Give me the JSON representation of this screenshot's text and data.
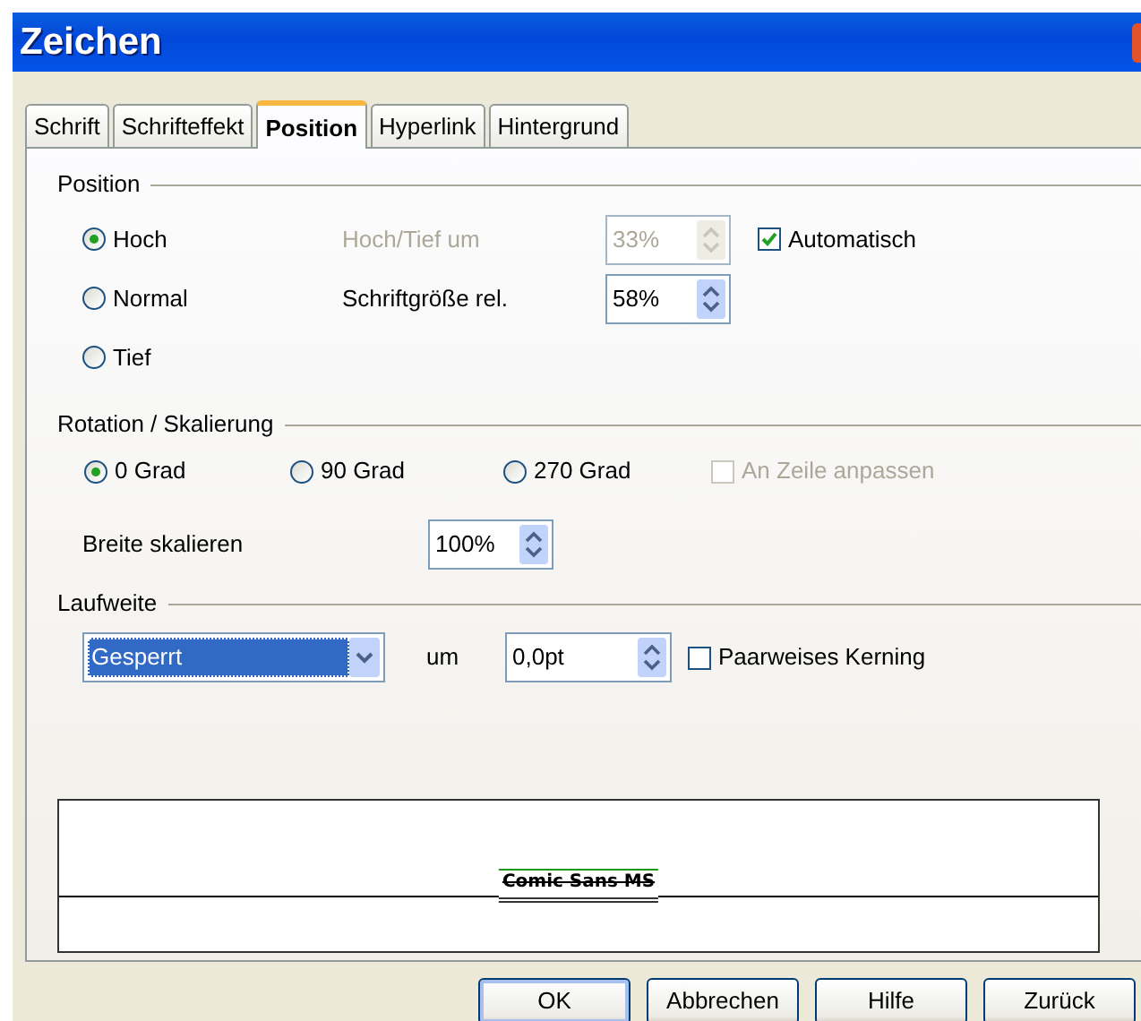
{
  "window": {
    "title": "Zeichen"
  },
  "tabs": [
    {
      "label": "Schrift",
      "selected": false
    },
    {
      "label": "Schrifteffekt",
      "selected": false
    },
    {
      "label": "Position",
      "selected": true
    },
    {
      "label": "Hyperlink",
      "selected": false
    },
    {
      "label": "Hintergrund",
      "selected": false
    }
  ],
  "position": {
    "title": "Position",
    "options": [
      {
        "label": "Hoch",
        "selected": true
      },
      {
        "label": "Normal",
        "selected": false
      },
      {
        "label": "Tief",
        "selected": false
      }
    ],
    "offset": {
      "label": "Hoch/Tief um",
      "value": "33%",
      "disabled": true
    },
    "automatic": {
      "label": "Automatisch",
      "checked": true,
      "disabled": false
    },
    "relative_size": {
      "label": "Schriftgröße rel.",
      "value": "58%",
      "disabled": false
    }
  },
  "rotation": {
    "title": "Rotation / Skalierung",
    "options": [
      {
        "label": "0 Grad",
        "selected": true
      },
      {
        "label": "90 Grad",
        "selected": false
      },
      {
        "label": "270 Grad",
        "selected": false
      }
    ],
    "fit_to_line": {
      "label": "An Zeile anpassen",
      "checked": false,
      "disabled": true
    },
    "scale_width": {
      "label": "Breite skalieren",
      "value": "100%",
      "disabled": false
    }
  },
  "spacing": {
    "title": "Laufweite",
    "mode": {
      "value": "Gesperrt",
      "highlighted": true
    },
    "by": {
      "label": "um",
      "value": "0,0pt",
      "disabled": false
    },
    "pair_kerning": {
      "label": "Paarweises Kerning",
      "checked": false,
      "disabled": false
    }
  },
  "preview": {
    "text": "Comic Sans MS"
  },
  "buttons": [
    {
      "label": "OK",
      "default": true
    },
    {
      "label": "Abbrechen",
      "default": false
    },
    {
      "label": "Hilfe",
      "default": false
    },
    {
      "label": "Zurück",
      "default": false
    }
  ]
}
